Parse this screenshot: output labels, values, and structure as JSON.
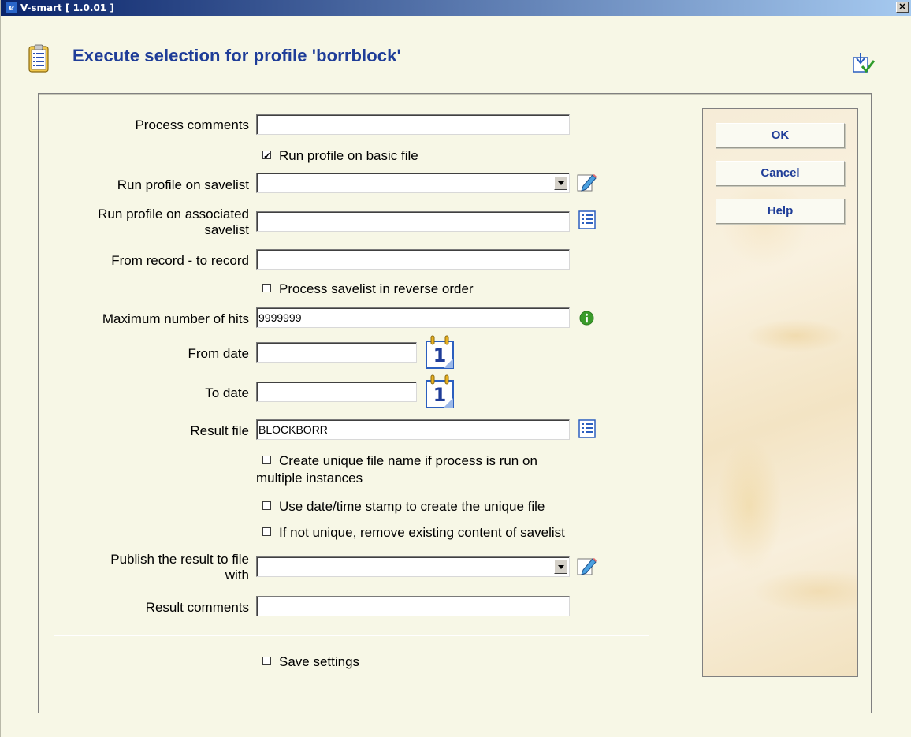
{
  "window": {
    "title": "V-smart [ 1.0.01 ]",
    "close_label": "✕"
  },
  "page": {
    "title": "Execute selection for profile 'borrblock'"
  },
  "form": {
    "process_comments": {
      "label": "Process comments",
      "value": ""
    },
    "run_on_basic_file": {
      "label": "Run profile on basic file",
      "checked": true
    },
    "run_on_savelist": {
      "label": "Run profile on savelist",
      "value": ""
    },
    "run_on_assoc_savelist": {
      "label_line1": "Run profile on associated",
      "label_line2": "savelist",
      "value": ""
    },
    "from_to_record": {
      "label": "From record - to record",
      "value": ""
    },
    "reverse_order": {
      "label": "Process savelist in reverse order",
      "checked": false
    },
    "max_hits": {
      "label": "Maximum number of hits",
      "value": "9999999"
    },
    "from_date": {
      "label": "From date",
      "value": "",
      "calendar_day": "1"
    },
    "to_date": {
      "label": "To date",
      "value": "",
      "calendar_day": "1"
    },
    "result_file": {
      "label": "Result file",
      "value": "BLOCKBORR"
    },
    "unique_name": {
      "label_line1": "Create unique file name if process is run on",
      "label_line2": "multiple instances",
      "checked": false
    },
    "date_stamp": {
      "label": "Use date/time stamp to create the unique file",
      "checked": false
    },
    "remove_existing": {
      "label": "If not unique, remove existing content of savelist",
      "checked": false
    },
    "publish": {
      "label_line1": "Publish the result to file",
      "label_line2": "with",
      "value": ""
    },
    "result_comments": {
      "label": "Result comments",
      "value": ""
    },
    "save_settings": {
      "label": "Save settings",
      "checked": false
    }
  },
  "sidebar": {
    "ok_label": "OK",
    "cancel_label": "Cancel",
    "help_label": "Help"
  },
  "colors": {
    "title_blue": "#1f3d98",
    "background": "#f7f7e6",
    "info_green": "#3a9b2a"
  }
}
